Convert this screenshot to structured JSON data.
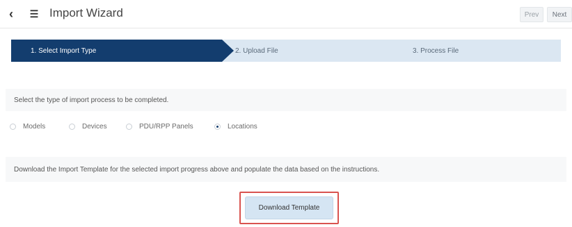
{
  "header": {
    "title": "Import Wizard",
    "prev_label": "Prev",
    "next_label": "Next"
  },
  "stepper": {
    "steps": [
      {
        "label": "1. Select Import Type",
        "active": true
      },
      {
        "label": "2. Upload File",
        "active": false
      },
      {
        "label": "3. Process File",
        "active": false
      }
    ]
  },
  "select_prompt": "Select the type of import process to be completed.",
  "import_types": [
    {
      "label": "Models",
      "selected": false
    },
    {
      "label": "Devices",
      "selected": false
    },
    {
      "label": "PDU/RPP Panels",
      "selected": false
    },
    {
      "label": "Locations",
      "selected": true
    }
  ],
  "download_prompt": "Download the Import Template for the selected import progress above and populate the data based on the instructions.",
  "download_button_label": "Download Template",
  "colors": {
    "active_step": "#133d6e",
    "inactive_step": "#dbe7f2",
    "highlight_border": "#d9534f",
    "button_bg": "#d5e5f3"
  }
}
